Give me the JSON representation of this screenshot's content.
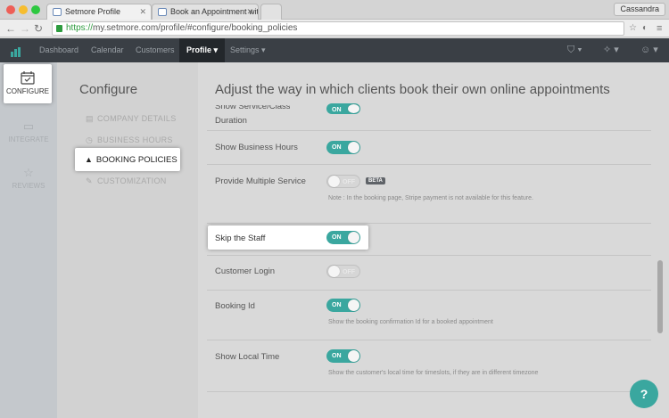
{
  "browser": {
    "tabs": [
      {
        "title": "Setmore Profile"
      },
      {
        "title": "Book an Appointment with"
      }
    ],
    "user": "Cassandra",
    "url_scheme": "https://",
    "url_rest": "my.setmore.com/profile/#configure/booking_policies"
  },
  "appnav": {
    "items": [
      "Dashboard",
      "Calendar",
      "Customers",
      "Profile ▾",
      "Settings ▾"
    ],
    "active_index": 3
  },
  "sidebar": {
    "configure": "CONFIGURE",
    "integrate": "INTEGRATE",
    "reviews": "REVIEWS"
  },
  "configure_menu": {
    "title": "Configure",
    "items": [
      "COMPANY DETAILS",
      "BUSINESS HOURS",
      "BOOKING POLICIES",
      "CUSTOMIZATION"
    ],
    "active": "BOOKING POLICIES"
  },
  "main": {
    "title": "Adjust the way in which clients book their own online appointments",
    "rows": [
      {
        "label_line1": "Show Service/Class",
        "label_line2": "Duration",
        "state": "ON"
      },
      {
        "label": "Show Business Hours",
        "state": "ON"
      },
      {
        "label": "Provide Multiple Service",
        "state": "OFF",
        "badge": "BETA",
        "note": "Note : In the booking page, Stripe payment is not available for this feature."
      },
      {
        "label": "Skip the Staff",
        "state": "ON"
      },
      {
        "label": "Customer Login",
        "state": "OFF"
      },
      {
        "label": "Booking Id",
        "state": "ON",
        "note": "Show the booking confirmation Id for a booked appointment"
      },
      {
        "label": "Show Local Time",
        "state": "ON",
        "note": "Show the customer's local time for timeslots, if they are in different timezone"
      }
    ]
  },
  "colors": {
    "accent": "#3aa79f",
    "nav_bg": "#3a3f45"
  }
}
